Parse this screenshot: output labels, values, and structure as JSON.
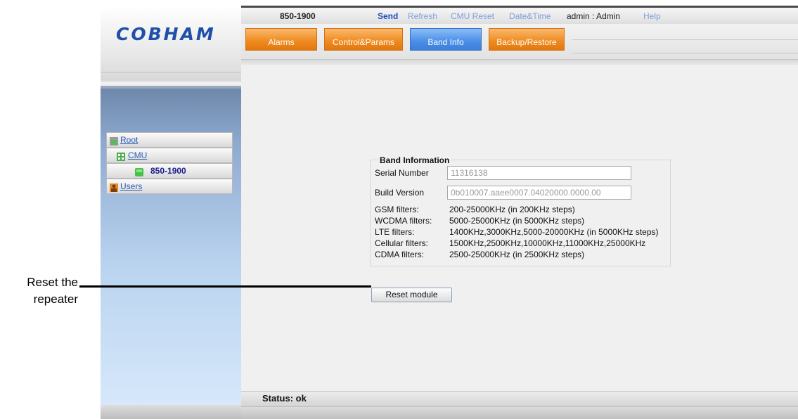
{
  "logo": "COBHAM",
  "topbar": {
    "model": "850-1900",
    "send": "Send",
    "refresh": "Refresh",
    "cmu_reset": "CMU Reset",
    "date_time": "Date&Time",
    "user": "admin : Admin",
    "help": "Help"
  },
  "tabs": [
    {
      "label": "Alarms",
      "active": false
    },
    {
      "label": "Control&Params",
      "active": false
    },
    {
      "label": "Band Info",
      "active": true
    },
    {
      "label": "Backup/Restore",
      "active": false
    }
  ],
  "tree": [
    {
      "label": "Root",
      "icon": "root-icon"
    },
    {
      "label": "CMU",
      "icon": "cmu-icon"
    },
    {
      "label": "850-1900",
      "icon": "module-green-icon",
      "selected": true
    },
    {
      "label": "Users",
      "icon": "users-icon"
    }
  ],
  "band_info": {
    "legend": "Band Information",
    "serial_label": "Serial Number",
    "serial_value": "11316138",
    "build_label": "Build Version",
    "build_value": "0b010007.aaee0007.04020000.0000.00",
    "filters": [
      {
        "label": "GSM filters:",
        "value": "200-25000KHz (in 200KHz steps)"
      },
      {
        "label": "WCDMA filters:",
        "value": "5000-25000KHz (in 5000KHz steps)"
      },
      {
        "label": "LTE filters:",
        "value": "1400KHz,3000KHz,5000-20000KHz (in 5000KHz steps)"
      },
      {
        "label": "Cellular filters:",
        "value": "1500KHz,2500KHz,10000KHz,11000KHz,25000KHz"
      },
      {
        "label": "CDMA filters:",
        "value": "2500-25000KHz (in 2500KHz steps)"
      }
    ]
  },
  "reset_button": "Reset module",
  "status": "Status: ok",
  "callout": {
    "line1": "Reset the",
    "line2": "repeater"
  },
  "colors": {
    "accent_orange": "#ef8a1e",
    "accent_blue": "#4a8ee8",
    "link_blue": "#2f5fb3"
  }
}
